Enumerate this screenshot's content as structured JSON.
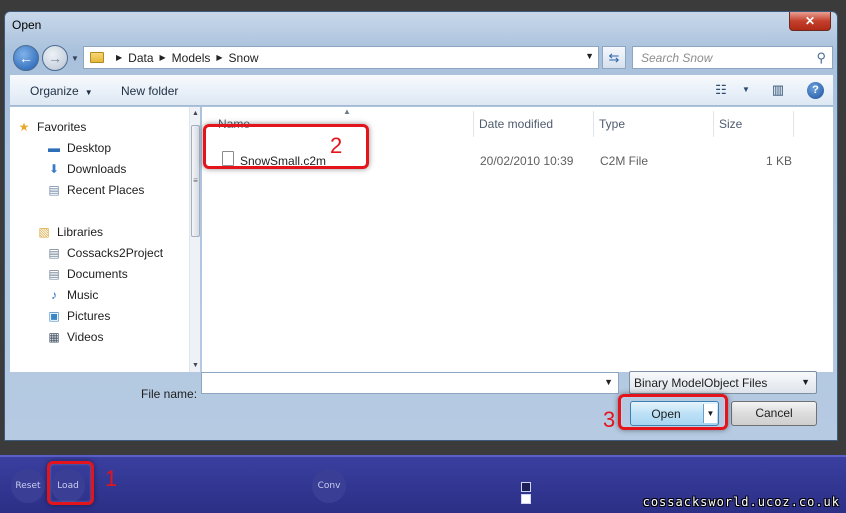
{
  "dialog": {
    "title": "Open",
    "close_label": "✕",
    "breadcrumb": [
      "Data",
      "Models",
      "Snow"
    ],
    "search_placeholder": "Search Snow",
    "toolbar": {
      "organize": "Organize",
      "new_folder": "New folder"
    },
    "nav": {
      "favorites_header": "Favorites",
      "favorites": [
        "Desktop",
        "Downloads",
        "Recent Places"
      ],
      "libraries_header": "Libraries",
      "libraries": [
        "Cossacks2Project",
        "Documents",
        "Music",
        "Pictures",
        "Videos"
      ]
    },
    "columns": {
      "name": "Name",
      "date": "Date modified",
      "type": "Type",
      "size": "Size"
    },
    "files": [
      {
        "name": "SnowSmall.c2m",
        "date": "20/02/2010 10:39",
        "type": "C2M File",
        "size": "1 KB"
      }
    ],
    "filename_label": "File name:",
    "filename_value": "",
    "filetype": "Binary ModelObject Files",
    "open_label": "Open",
    "cancel_label": "Cancel"
  },
  "app": {
    "buttons": {
      "reset": "Reset",
      "load": "Load",
      "conv": "Conv"
    }
  },
  "annotations": {
    "step1": "1",
    "step2": "2",
    "step3": "3"
  },
  "watermark": "cossacksworld.ucoz.co.uk",
  "colors": {
    "callout": "#e3141b",
    "app_bg": "#2a2f6e",
    "dialog_frame": "#b6cbe2"
  }
}
